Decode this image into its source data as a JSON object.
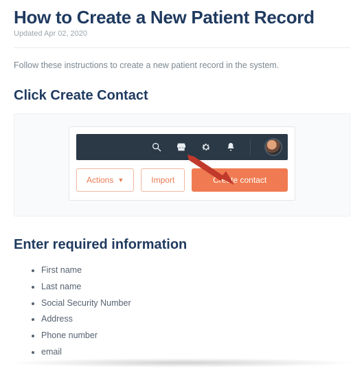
{
  "header": {
    "title": "How to Create a New Patient Record",
    "updated": "Updated Apr 02, 2020"
  },
  "intro": "Follow these instructions to create a new patient record in the system.",
  "sections": {
    "click_create": {
      "heading": "Click Create Contact",
      "buttons": {
        "actions": "Actions",
        "import": "Import",
        "create_contact": "Create contact"
      }
    },
    "required_info": {
      "heading": "Enter required information",
      "items": [
        "First name",
        "Last name",
        "Social Security Number",
        "Address",
        "Phone number",
        "email"
      ]
    }
  }
}
